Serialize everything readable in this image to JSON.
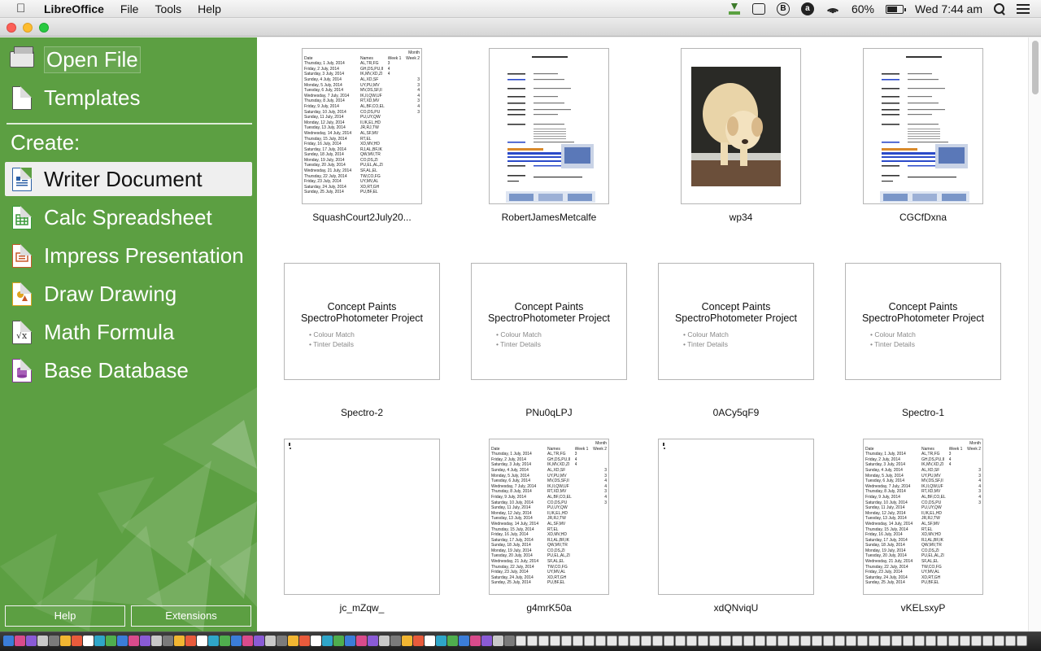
{
  "menubar": {
    "app_name": "LibreOffice",
    "menus": [
      "File",
      "Tools",
      "Help"
    ],
    "battery_percent": "60%",
    "clock": "Wed 7:44 am",
    "status_icons": [
      "download-icon",
      "quotes-icon",
      "b-icon",
      "a-icon",
      "wifi-icon",
      "battery-icon",
      "spotlight-icon",
      "notification-list-icon"
    ]
  },
  "sidebar": {
    "open_file": "Open File",
    "templates": "Templates",
    "create_label": "Create:",
    "create_items": [
      {
        "label": "Writer Document",
        "icon": "writer-icon",
        "active": true
      },
      {
        "label": "Calc Spreadsheet",
        "icon": "calc-icon"
      },
      {
        "label": "Impress Presentation",
        "icon": "impress-icon"
      },
      {
        "label": "Draw Drawing",
        "icon": "draw-icon"
      },
      {
        "label": "Math Formula",
        "icon": "math-icon"
      },
      {
        "label": "Base Database",
        "icon": "base-icon"
      }
    ],
    "help_button": "Help",
    "extensions_button": "Extensions"
  },
  "colors": {
    "sidebar_green": "#5c9f42",
    "writer": "#2b5fa5",
    "calc": "#3a9a3a",
    "impress": "#c8592a",
    "draw": "#e0a31e",
    "math": "#555555",
    "base": "#8a3a9e"
  },
  "recent_documents": [
    {
      "name": "SquashCourt2July20...",
      "kind": "spreadsheet"
    },
    {
      "name": "RobertJamesMetcalfe",
      "kind": "cv"
    },
    {
      "name": "wp34",
      "kind": "photo"
    },
    {
      "name": "CGCfDxna",
      "kind": "cv"
    },
    {
      "name": "Spectro-2",
      "kind": "presentation"
    },
    {
      "name": "PNu0qLPJ",
      "kind": "presentation"
    },
    {
      "name": "0ACy5qF9",
      "kind": "presentation"
    },
    {
      "name": "Spectro-1",
      "kind": "presentation"
    },
    {
      "name": "jc_mZqw_",
      "kind": "blank"
    },
    {
      "name": "g4mrK50a",
      "kind": "spreadsheet"
    },
    {
      "name": "xdQNviqU",
      "kind": "blank"
    },
    {
      "name": "vKELsxyP",
      "kind": "spreadsheet"
    }
  ],
  "presentation_preview": {
    "title_line1": "Concept Paints",
    "title_line2": "SpectroPhotometer Project",
    "bullets": [
      "Colour Match",
      "Tinter Details"
    ]
  },
  "spreadsheet_preview": {
    "header_month": "Month",
    "columns": [
      "Date",
      "Names",
      "Week 1",
      "Week 2"
    ],
    "rows": [
      [
        "Thursday, 1 July, 2014",
        "AL,TR,FG",
        "3",
        ""
      ],
      [
        "Friday, 2 July, 2014",
        "GH,DS,PU,II",
        "4",
        ""
      ],
      [
        "Saturday, 3 July, 2014",
        "IK,MV,XD,ZI",
        "4",
        ""
      ],
      [
        "Sunday, 4 July, 2014",
        "AL,XD,SF",
        "",
        "3"
      ],
      [
        "Monday, 5 July, 2014",
        "UY,PU,MV",
        "",
        "3"
      ],
      [
        "Tuesday, 6 July, 2014",
        "MV,DS,SF,II",
        "",
        "4"
      ],
      [
        "Wednesday, 7 July, 2014",
        "IK,II,QW,UF",
        "",
        "4"
      ],
      [
        "Thursday, 8 July, 2014",
        "RT,XD,MV",
        "",
        "3"
      ],
      [
        "Friday, 9 July, 2014",
        "AL,BF,CO,EL",
        "",
        "4"
      ],
      [
        "Saturday, 10 July, 2014",
        "CO,DS,PU",
        "",
        "3"
      ],
      [
        "Sunday, 11 July, 2014",
        "PU,UY,QW",
        "",
        ""
      ],
      [
        "Monday, 12 July, 2014",
        "II,IK,EL,HD",
        "",
        ""
      ],
      [
        "Tuesday, 13 July, 2014",
        "JR,RJ,TW",
        "",
        ""
      ],
      [
        "Wednesday, 14 July, 2014",
        "AL,SF,MV",
        "",
        ""
      ],
      [
        "Thursday, 15 July, 2014",
        "RT,EL",
        "",
        ""
      ],
      [
        "Friday, 16 July, 2014",
        "XD,MV,HD",
        "",
        ""
      ],
      [
        "Saturday, 17 July, 2014",
        "RJ,AL,BF,IK",
        "",
        ""
      ],
      [
        "Sunday, 18 July, 2014",
        "QW,MV,TR",
        "",
        ""
      ],
      [
        "Monday, 19 July, 2014",
        "CO,DS,ZI",
        "",
        ""
      ],
      [
        "Tuesday, 20 July, 2014",
        "PU,EL,AL,ZI",
        "",
        ""
      ],
      [
        "Wednesday, 21 July, 2014",
        "SF,AL,EL",
        "",
        ""
      ],
      [
        "Thursday, 22 July, 2014",
        "TW,CO,FG",
        "",
        ""
      ],
      [
        "Friday, 23 July, 2014",
        "UY,MV,AL",
        "",
        ""
      ],
      [
        "Saturday, 24 July, 2014",
        "XD,RT,GH",
        "",
        ""
      ],
      [
        "Sunday, 25 July, 2014",
        "PU,BF,EL",
        "",
        ""
      ]
    ]
  }
}
